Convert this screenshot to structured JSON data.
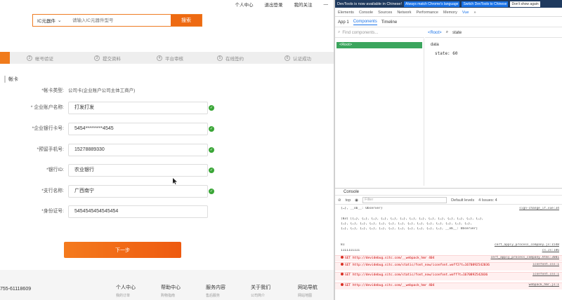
{
  "page": {
    "topnav": [
      "个人中心",
      "退出登录",
      "我的关注",
      "—"
    ],
    "search": {
      "category": "IC元器件",
      "placeholder": "请输入IC元器件型号",
      "button": "搜索"
    },
    "steps": [
      {
        "num": "2",
        "label": "帐号验证"
      },
      {
        "num": "3",
        "label": "提交资料"
      },
      {
        "num": "4",
        "label": "平台审核"
      },
      {
        "num": "5",
        "label": "在线签约"
      },
      {
        "num": "6",
        "label": "认证成功"
      }
    ],
    "section_label": "帐卡",
    "form": {
      "account_type_label": "*帐卡类型:",
      "account_type_value": "公司卡(企业账户公司主体工商户)",
      "fields": [
        {
          "label": "* 企业账户名称:",
          "value": "打发打发"
        },
        {
          "label": "*企业银行卡号:",
          "value": "5454*********4545"
        },
        {
          "label": "*预留手机号:",
          "value": "15278889330"
        },
        {
          "label": "*银行ID:",
          "value": "农业银行"
        },
        {
          "label": "*支行名称:",
          "value": "广西南宁"
        },
        {
          "label": "*身份证号:",
          "value": "5454545454545454"
        }
      ],
      "next_button": "下一步"
    },
    "footer": {
      "phone": "755-61118609",
      "columns": [
        {
          "title": "个人中心",
          "sub": "我的订单"
        },
        {
          "title": "帮助中心",
          "sub": "购物指南"
        },
        {
          "title": "服务内容",
          "sub": "售后服务"
        },
        {
          "title": "关于我们",
          "sub": "公司简介"
        },
        {
          "title": "网站导航",
          "sub": "网站地图"
        }
      ]
    }
  },
  "devtools": {
    "notice": {
      "message": "DevTools is now available in Chinese!",
      "btn_match": "Always match Chrome's language",
      "btn_switch": "Switch DevTools to Chinese",
      "btn_dont": "Don't show again"
    },
    "tabs": [
      "Elements",
      "Console",
      "Sources",
      "Network",
      "Performance",
      "Memory",
      "Vue",
      "»"
    ],
    "active_tab": "Vue",
    "vue_bar": {
      "app": "App 1",
      "components": "Components",
      "timeline": "Timeline"
    },
    "find_placeholder": "Find components...",
    "crumb": {
      "root": "<Root>",
      "filter": "state"
    },
    "tree_root": "<Root>",
    "state": {
      "section": "data",
      "entry": "state: 60"
    },
    "console": {
      "title": "Console",
      "context": "top",
      "filter_placeholder": "Filter",
      "levels": "Default levels",
      "issues": "4 Issues: 4",
      "lines": [
        {
          "text": "{…}, __ob__: Observer}",
          "src": "sign-change_if.vue:34",
          "type": "log"
        },
        {
          "text": "(83) [{…}, {…}, {…}, {…}, {…}, {…}, {…}, {…}, {…}, {…}, {…}, {…}, {…}, {…},",
          "src": "",
          "type": "log"
        },
        {
          "text": "  {…}, {…}, {…}, {…}, {…}, {…}, {…}, {…}, {…}, {…}, {…}, {…}, {…}, {…},",
          "src": "",
          "type": "log"
        },
        {
          "text": "  {…}, {…}, {…}, {…}, {…}, {…}, {…}, {…}, {…}, {…}, {…}, __ob__: Observer]",
          "src": "",
          "type": "log"
        },
        {
          "text": "81",
          "src": "cert_apply_process_company.js:1548",
          "type": "log"
        },
        {
          "text": "1111111111",
          "src": "cs.Js:186",
          "type": "log"
        },
        {
          "text": "GET http://devidebug.sitc.com/__webpack_hmr 404",
          "src": "cert_apply_process_company.html:3001",
          "type": "err"
        },
        {
          "text": "GET http://devidebug.sitc.com/static/font_now/iconfont.woff2?t=1670892542036",
          "src": "iconfont.css:1",
          "type": "err"
        },
        {
          "text": "GET http://devidebug.sitc.com/static/font_now/iconfont.woff?t=1670892542036",
          "src": "iconfont.css:1",
          "type": "err"
        },
        {
          "text": "GET http://devidebug.sitc.com/__webpack_hmr 404",
          "src": "webpack_hmr.js:1",
          "type": "err"
        }
      ]
    }
  }
}
